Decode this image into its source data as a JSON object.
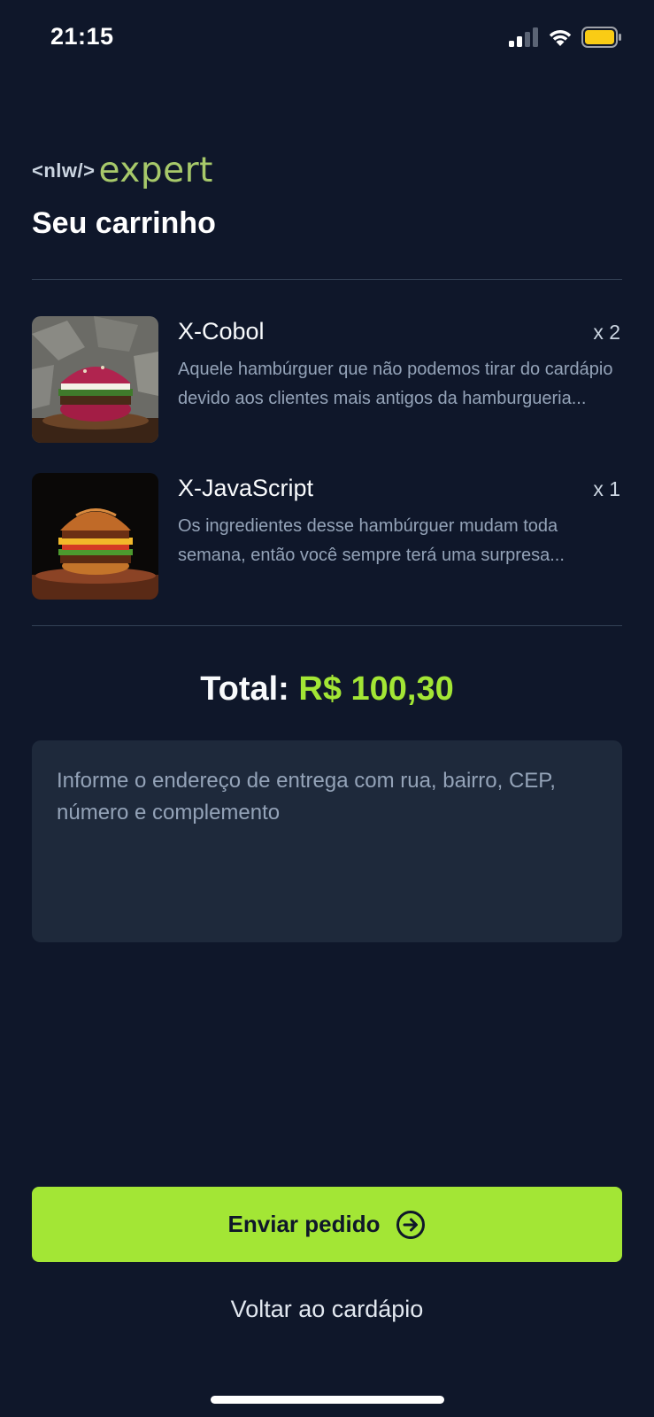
{
  "status_bar": {
    "time": "21:15",
    "icons": [
      "cellular-signal-icon",
      "wifi-icon",
      "battery-icon"
    ],
    "battery_color": "#facc15"
  },
  "logo": {
    "nlw": "<nlw/>",
    "expert": "expert"
  },
  "header": {
    "title": "Seu carrinho"
  },
  "cart": {
    "items": [
      {
        "title": "X-Cobol",
        "quantity": "x 2",
        "description": "Aquele hambúrguer que não podemos tirar do cardápio devido aos clientes mais antigos da hamburgueria..."
      },
      {
        "title": "X-JavaScript",
        "quantity": "x 1",
        "description": "Os ingredientes desse hambúrguer mudam toda semana, então você sempre terá uma surpresa..."
      }
    ]
  },
  "total": {
    "label": "Total:",
    "value": "R$ 100,30"
  },
  "address": {
    "placeholder": "Informe o endereço de entrega com rua, bairro, CEP, número e complemento",
    "value": ""
  },
  "actions": {
    "send_label": "Enviar pedido",
    "send_icon": "arrow-circle-right-icon",
    "back_label": "Voltar ao cardápio"
  },
  "colors": {
    "background": "#0f172a",
    "accent": "#a3e635",
    "input_bg": "#1e293b"
  }
}
